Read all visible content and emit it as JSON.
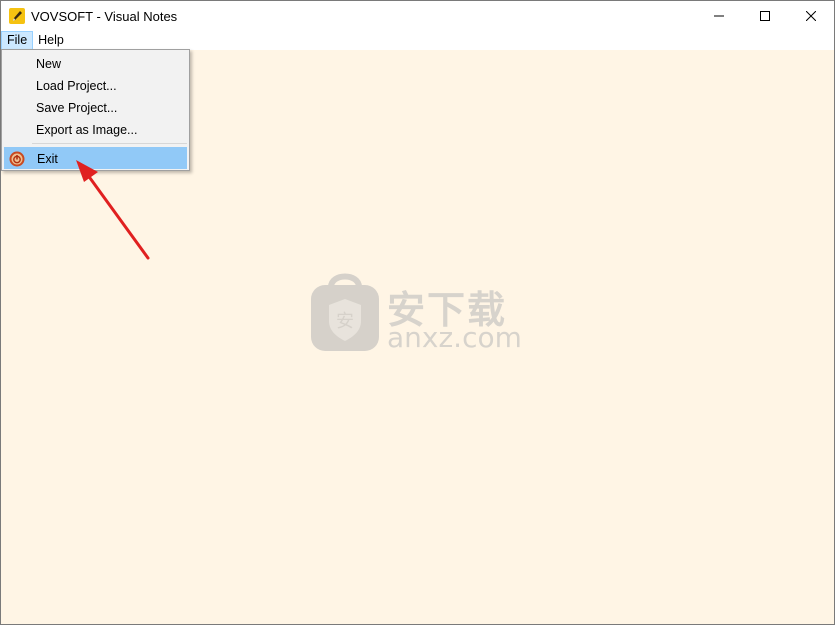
{
  "window": {
    "title": "VOVSOFT - Visual Notes",
    "controls": {
      "minimize": "minimize-icon",
      "maximize": "maximize-icon",
      "close": "close-icon"
    }
  },
  "menubar": {
    "items": [
      {
        "label": "File",
        "active": true
      },
      {
        "label": "Help",
        "active": false
      }
    ]
  },
  "file_menu": {
    "items": [
      {
        "label": "New"
      },
      {
        "label": "Load Project..."
      },
      {
        "label": "Save Project..."
      },
      {
        "label": "Export as Image..."
      },
      {
        "label": "Exit",
        "icon": "power-icon",
        "highlighted": true
      }
    ]
  },
  "watermark": {
    "cn_text": "安下载",
    "en_text": "anxz.com"
  },
  "colors": {
    "canvas_bg": "#fff5e5",
    "menu_highlight": "#91c9f7",
    "active_menubar": "#cce8ff",
    "annotation_arrow": "#e02020"
  }
}
